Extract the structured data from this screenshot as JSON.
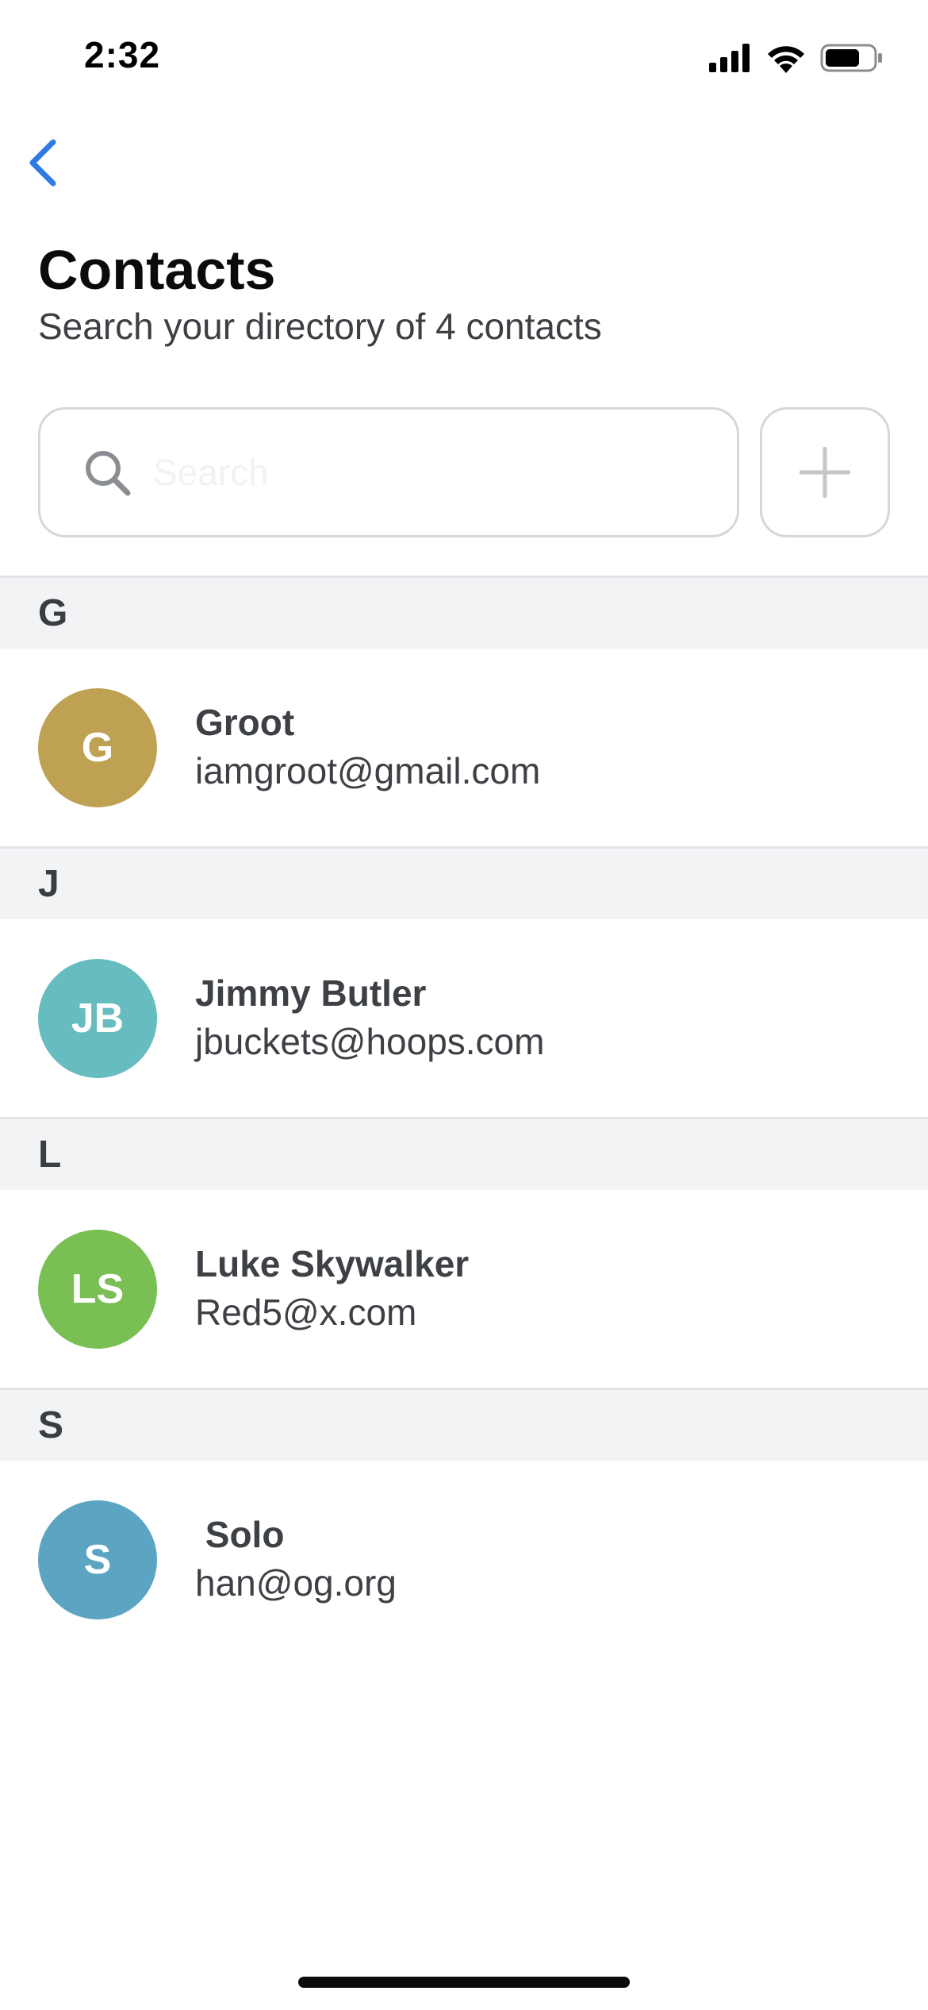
{
  "status_bar": {
    "time": "2:32",
    "icons": [
      "cellular-signal-icon",
      "wifi-icon",
      "battery-icon"
    ]
  },
  "nav": {
    "back_icon": "chevron-left-icon",
    "accent_color": "#2f7ae5"
  },
  "header": {
    "title": "Contacts",
    "subtitle": "Search your directory of 4 contacts"
  },
  "search": {
    "value": "",
    "placeholder": "Search",
    "icon": "search-icon"
  },
  "add_button": {
    "icon": "plus-icon"
  },
  "sections": [
    {
      "letter": "G",
      "contacts": [
        {
          "initials": "G",
          "name": "Groot",
          "email": "iamgroot@gmail.com",
          "avatar_color": "#bfa154"
        }
      ]
    },
    {
      "letter": "J",
      "contacts": [
        {
          "initials": "JB",
          "name": "Jimmy Butler",
          "email": "jbuckets@hoops.com",
          "avatar_color": "#66bcbf"
        }
      ]
    },
    {
      "letter": "L",
      "contacts": [
        {
          "initials": "LS",
          "name": "Luke Skywalker",
          "email": "Red5@x.com",
          "avatar_color": "#79bf54"
        }
      ]
    },
    {
      "letter": "S",
      "contacts": [
        {
          "initials": "S",
          "name": " Solo",
          "email": "han@og.org",
          "avatar_color": "#5ba4c2"
        }
      ]
    }
  ]
}
